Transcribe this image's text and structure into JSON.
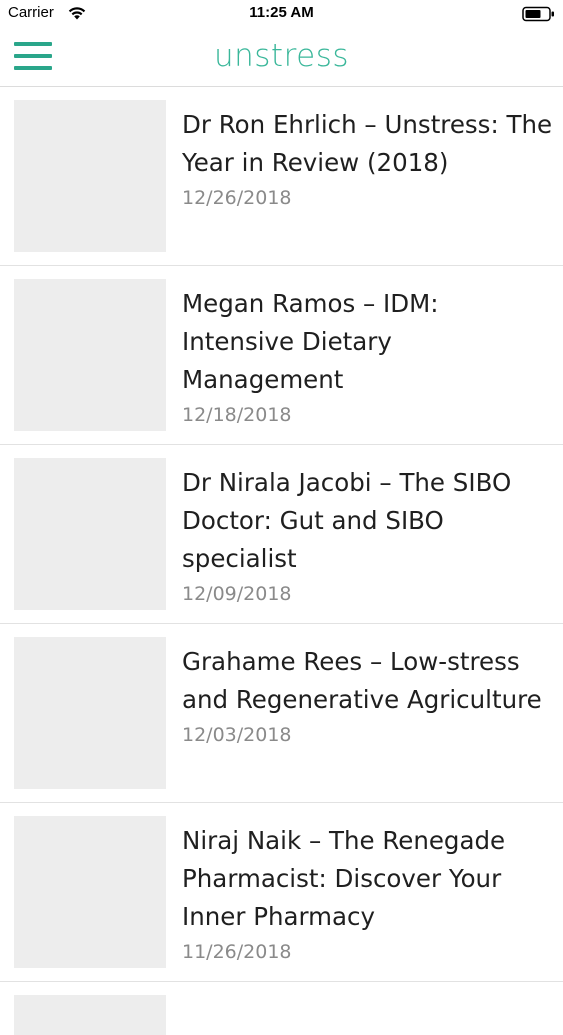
{
  "status_bar": {
    "carrier": "Carrier",
    "time": "11:25 AM",
    "wifi_icon": "wifi-icon",
    "battery_icon": "battery-icon"
  },
  "header": {
    "logo_text": "unstress",
    "menu_icon": "hamburger-menu-icon",
    "accent_color": "#2aa68a"
  },
  "articles": [
    {
      "title": "Dr Ron Ehrlich – Unstress: The Year in Review (2018)",
      "date": "12/26/2018"
    },
    {
      "title": "Megan Ramos – IDM: Intensive Dietary Management",
      "date": "12/18/2018"
    },
    {
      "title": "Dr Nirala Jacobi – The SIBO Doctor: Gut and SIBO specialist",
      "date": "12/09/2018"
    },
    {
      "title": "Grahame Rees – Low-stress and Regenerative Agriculture",
      "date": "12/03/2018"
    },
    {
      "title": "Niraj Naik – The Renegade Pharmacist: Discover Your Inner Pharmacy",
      "date": "11/26/2018"
    }
  ]
}
